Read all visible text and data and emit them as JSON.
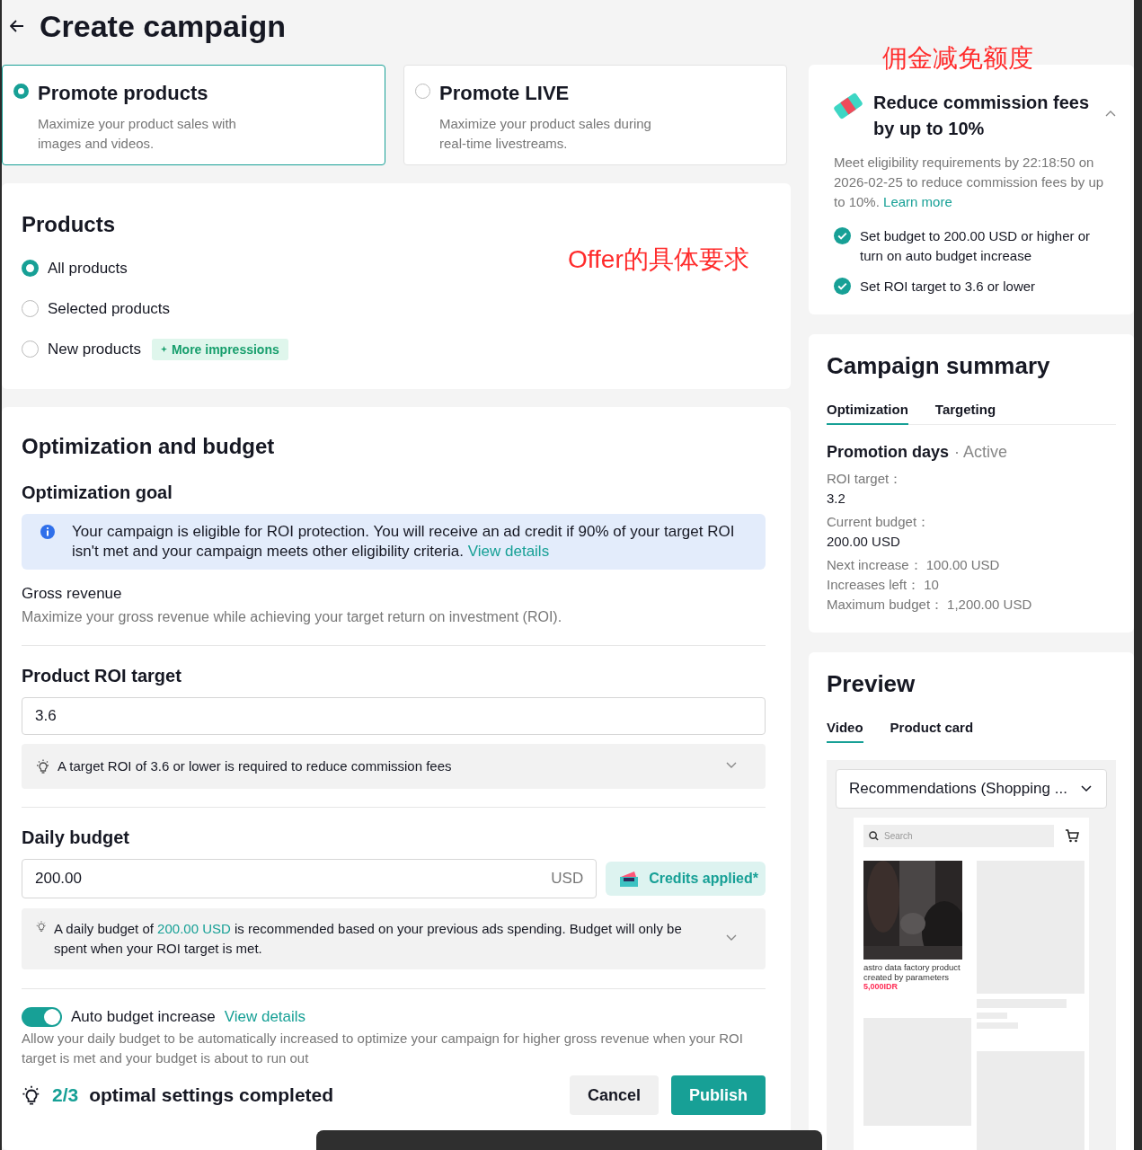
{
  "header": {
    "title": "Create campaign"
  },
  "campaign_types": [
    {
      "title": "Promote products",
      "description": "Maximize your product sales with images and videos.",
      "selected": true
    },
    {
      "title": "Promote LIVE",
      "description": "Maximize your product sales during real-time livestreams.",
      "selected": false
    }
  ],
  "annotations": [
    "佣金减免额度",
    "Offer的具体要求"
  ],
  "products": {
    "title": "Products",
    "options": [
      {
        "label": "All products",
        "selected": true
      },
      {
        "label": "Selected products",
        "selected": false
      },
      {
        "label": "New products",
        "selected": false,
        "badge": "More impressions"
      }
    ]
  },
  "optimization": {
    "title": "Optimization and budget",
    "goal_label": "Optimization goal",
    "notice": "Your campaign is eligible for ROI protection. You will receive an ad credit if 90% of your target ROI isn't met and your campaign meets other eligibility criteria.",
    "notice_link": "View details",
    "goal": "Gross revenue",
    "goal_description": "Maximize your gross revenue while achieving your target return on investment (ROI).",
    "roi_label": "Product ROI target",
    "roi_value": "3.6",
    "roi_tip": "A target ROI of 3.6 or lower is required to reduce commission fees",
    "budget_label": "Daily budget",
    "budget_value": "200.00",
    "budget_currency": "USD",
    "credits": "Credits applied*",
    "budget_tip": "A daily budget of **200.00 USD** is recommended based on your previous ads spending. Budget will only be spent when your ROI target is met.",
    "auto_budget": {
      "label": "Auto budget increase",
      "on": true,
      "link": "View details",
      "description": "Allow your daily budget to be automatically increased to optimize your campaign for higher gross revenue when your ROI target is met and your budget is about to run out"
    }
  },
  "footer": {
    "progress": "2/3",
    "progress_label": "optimal settings completed",
    "buttons": [
      "Cancel",
      "Publish"
    ]
  },
  "commission": {
    "title": "Reduce commission fees by up to 10%",
    "expanded": true,
    "text": "Meet eligibility requirements by 22:18:50 on 2026-02-25 to reduce commission fees by up to 10%.",
    "link": "Learn more",
    "requirements": [
      {
        "label": "Set budget to 200.00 USD or higher or turn on auto budget increase",
        "done": true
      },
      {
        "label": "Set ROI target to 3.6 or lower",
        "done": true
      }
    ]
  },
  "summary": {
    "title": "Campaign summary",
    "tabs": [
      {
        "label": "Optimization",
        "selected": true
      },
      {
        "label": "Targeting",
        "selected": false
      }
    ],
    "section": "Promotion days",
    "status": "· Active",
    "fields": [
      {
        "kind": "stacked",
        "label": "ROI target：",
        "value": "3.2"
      },
      {
        "kind": "stacked",
        "label": "Current budget：",
        "value": "200.00 USD"
      },
      {
        "kind": "inline",
        "label": "Next increase：",
        "value": "100.00 USD"
      },
      {
        "kind": "inline",
        "label": "Increases left：",
        "value": "10"
      },
      {
        "kind": "inline",
        "label": "Maximum budget：",
        "value": "1,200.00 USD"
      }
    ]
  },
  "preview": {
    "title": "Preview",
    "tabs": [
      {
        "label": "Video",
        "selected": true
      },
      {
        "label": "Product card",
        "selected": false
      }
    ],
    "placement": "Recommendations (Shopping ...",
    "search_placeholder": "Search",
    "product": {
      "name": "astro data factory product created by parameters",
      "price": "5,000IDR"
    }
  }
}
